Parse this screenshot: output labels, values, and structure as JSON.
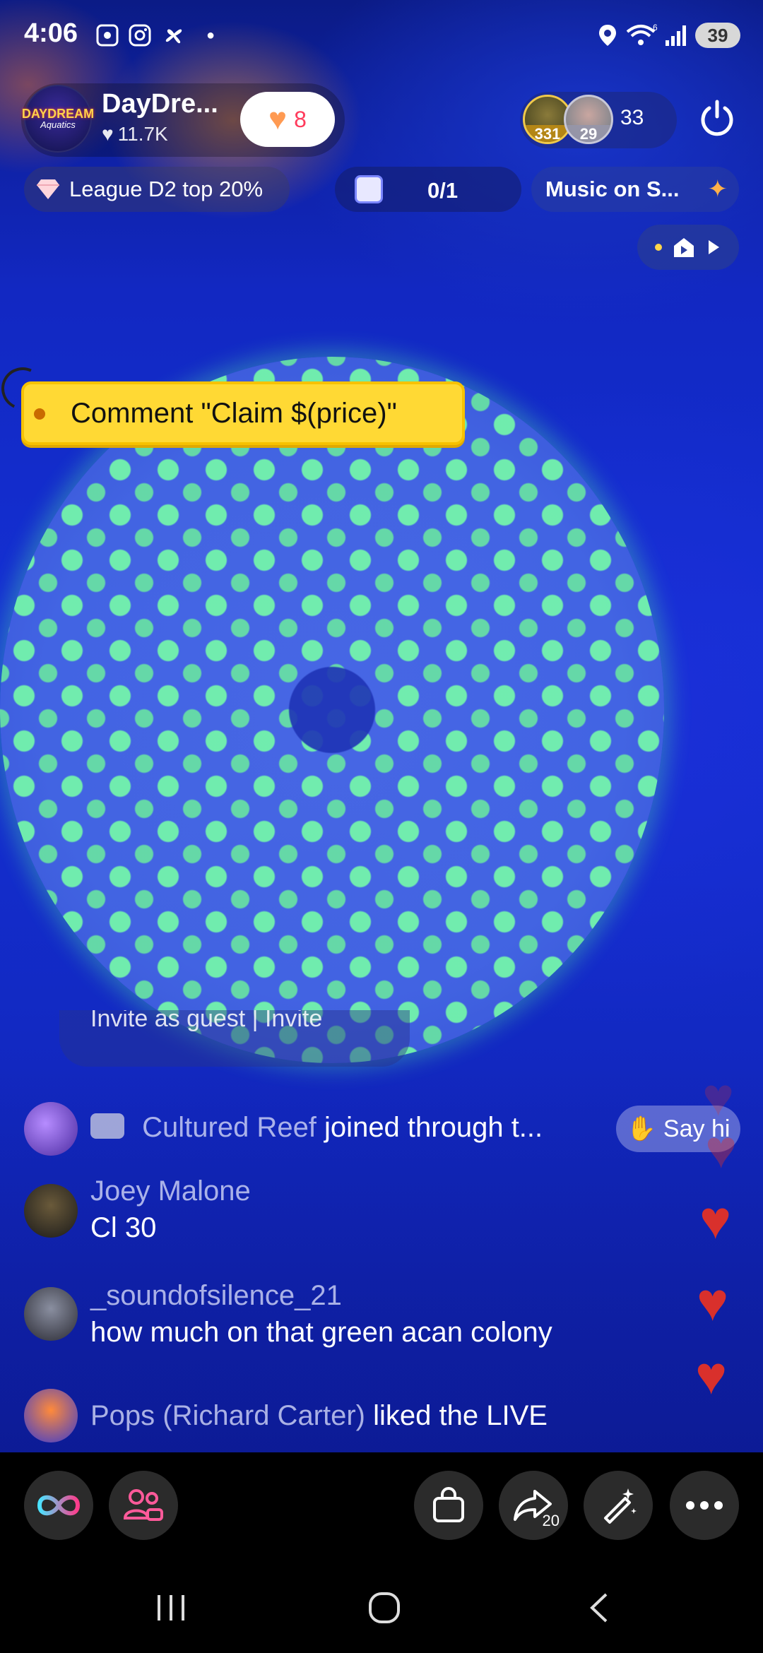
{
  "status_bar": {
    "time": "4:06",
    "battery": "39",
    "signal": "6"
  },
  "host": {
    "name": "DayDre...",
    "avatar_text_1": "DAYDREAM",
    "avatar_text_2": "Aquatics",
    "likes": "11.7K"
  },
  "follow": {
    "count": "8"
  },
  "viewers": {
    "top1_score": "331",
    "top2_score": "29",
    "count": "33"
  },
  "league": {
    "label": "League D2 top 20%"
  },
  "goal": {
    "progress": "0/1"
  },
  "music": {
    "label": "Music on S..."
  },
  "claim_sticker": {
    "text": "Comment \"Claim $(price)\""
  },
  "invite": {
    "text": "Invite as guest  |  Invite"
  },
  "join_event": {
    "user": "Cultured Reef",
    "text": "joined through t..."
  },
  "say_hi": {
    "label": "Say hi"
  },
  "comments": [
    {
      "user": "Joey Malone",
      "text": "Cl 30"
    },
    {
      "user": "_soundofsilence_21",
      "text": "how much on that green acan colony"
    }
  ],
  "like_event": {
    "user": "Pops (Richard Carter)",
    "text": "liked the LIVE"
  },
  "toolbar": {
    "share_count": "20"
  },
  "colors": {
    "accent_pink": "#ff3b5c",
    "heart_orange": "#ff9a52",
    "sticker_yellow": "#ffd934",
    "float_heart": "#d9302c"
  }
}
